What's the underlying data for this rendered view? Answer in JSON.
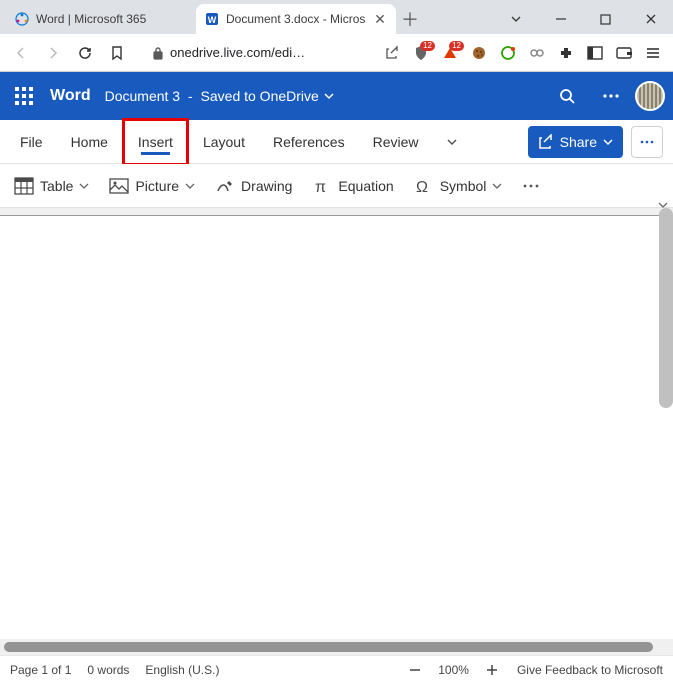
{
  "browser": {
    "tabs": [
      {
        "title": "Word | Microsoft 365"
      },
      {
        "title": "Document 3.docx - Micros"
      }
    ],
    "url": "onedrive.live.com/edi…",
    "ext_badges": {
      "brave": "12",
      "triangle": "12"
    }
  },
  "header": {
    "app_name": "Word",
    "doc_name": "Document 3",
    "save_state": "Saved to OneDrive"
  },
  "ribbon": {
    "tabs": [
      "File",
      "Home",
      "Insert",
      "Layout",
      "References",
      "Review"
    ],
    "active": "Insert",
    "share_label": "Share"
  },
  "toolbar": {
    "items": [
      {
        "label": "Table",
        "icon": "table"
      },
      {
        "label": "Picture",
        "icon": "picture"
      },
      {
        "label": "Drawing",
        "icon": "drawing"
      },
      {
        "label": "Equation",
        "icon": "equation"
      },
      {
        "label": "Symbol",
        "icon": "symbol"
      }
    ]
  },
  "status": {
    "page": "Page 1 of 1",
    "words": "0 words",
    "language": "English (U.S.)",
    "zoom": "100%",
    "feedback": "Give Feedback to Microsoft"
  }
}
